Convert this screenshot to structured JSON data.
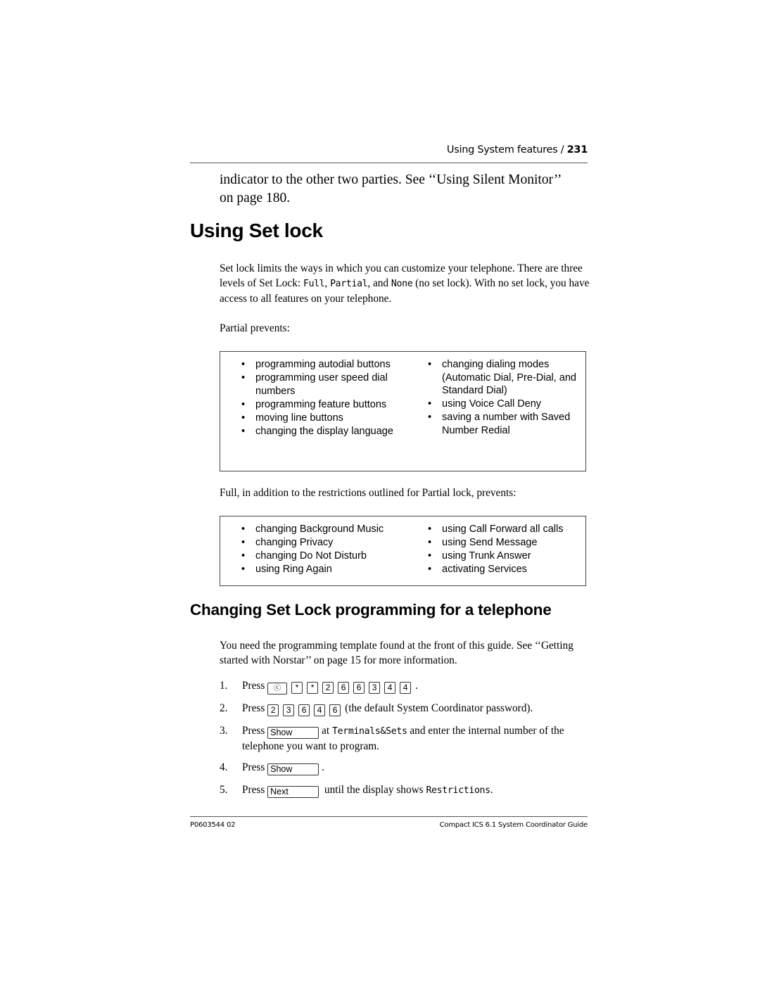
{
  "header": {
    "section": "Using System features /",
    "page_number": "231"
  },
  "continuation": {
    "text_before": "indicator to the other two parties. See ‘‘Using Silent Monitor’’",
    "text_after": "on page 180."
  },
  "section_title": "Using Set lock",
  "intro": {
    "part1": "Set lock limits the ways in which you can customize your telephone. There are three levels of Set Lock: ",
    "level_full": "Full",
    "sep1": ", ",
    "level_partial": "Partial",
    "sep2": ", and ",
    "level_none": "None",
    "part2": " (no set lock). With no set lock, you have access to all features on your telephone."
  },
  "partial": {
    "label": "Partial prevents:",
    "left": [
      "programming autodial buttons",
      "programming user speed dial numbers",
      "programming feature buttons",
      "moving line buttons",
      "changing the display language"
    ],
    "right": [
      "changing dialing modes (Automatic Dial, Pre-Dial, and Standard Dial)",
      "using Voice Call Deny",
      "saving a number with Saved Number Redial"
    ]
  },
  "full": {
    "label": "Full, in addition to the restrictions outlined for Partial lock, prevents:",
    "left": [
      "changing Background Music",
      "changing Privacy",
      "changing Do Not Disturb",
      "using Ring Again"
    ],
    "right": [
      "using Call Forward all calls",
      "using Send Message",
      "using Trunk Answer",
      "activating Services"
    ]
  },
  "subsection_title": "Changing Set Lock programming for a telephone",
  "subsection_intro": "You need the programming template found at the front of this guide. See ‘‘Getting started with Norstar’’ on page 15 for more information.",
  "bullet_glyph": "•",
  "steps": [
    {
      "number": "1.",
      "press": "Press",
      "keys": [
        "feature-key",
        "*",
        "*",
        "2",
        "6",
        "6",
        "3",
        "4",
        "4"
      ],
      "feature_key_glyph": "ⓒ",
      "after": "."
    },
    {
      "number": "2.",
      "press": "Press",
      "keys": [
        "2",
        "3",
        "6",
        "4",
        "6"
      ],
      "after": "(the default System Coordinator password)."
    },
    {
      "number": "3.",
      "press": "Press",
      "softkey": "Show",
      "at": "at ",
      "display": "Terminals&Sets",
      "after": " and enter the internal number of the telephone you want to program."
    },
    {
      "number": "4.",
      "press": "Press",
      "softkey": "Show",
      "after": "."
    },
    {
      "number": "5.",
      "press": "Press",
      "softkey": "Next",
      "after": "until the display shows ",
      "display": "Restrictions",
      "end": "."
    }
  ],
  "footer": {
    "doc_number": "P0603544  02",
    "guide_title": "Compact ICS 6.1 System Coordinator Guide"
  }
}
